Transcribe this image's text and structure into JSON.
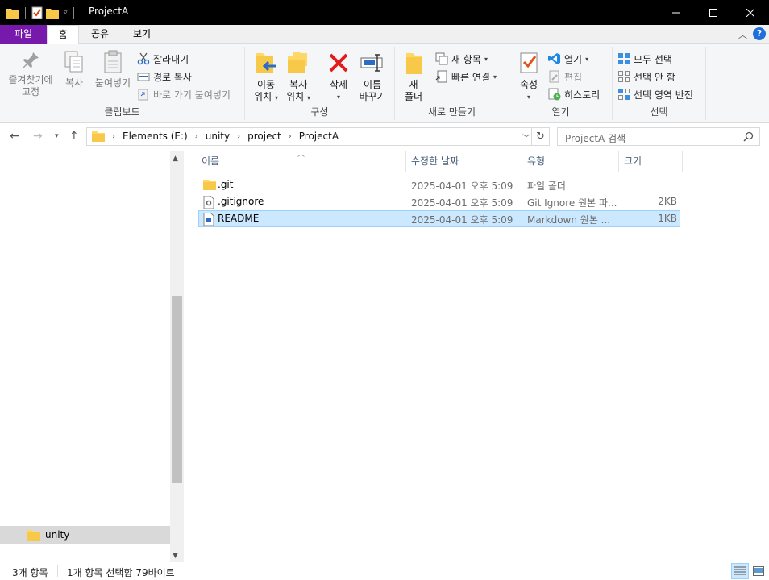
{
  "window": {
    "title": "ProjectA",
    "minimize_icon": "minimize-icon",
    "maximize_icon": "maximize-icon",
    "close_icon": "close-icon"
  },
  "tabs": {
    "file": "파일",
    "home": "홈",
    "share": "공유",
    "view": "보기"
  },
  "ribbon": {
    "clipboard": {
      "label": "클립보드",
      "pin_line1": "즐겨찾기에",
      "pin_line2": "고정",
      "copy": "복사",
      "paste": "붙여넣기",
      "cut": "잘라내기",
      "copy_path": "경로 복사",
      "paste_shortcut": "바로 가기 붙여넣기"
    },
    "organize": {
      "label": "구성",
      "move_line1": "이동",
      "move_line2": "위치",
      "copy_line1": "복사",
      "copy_line2": "위치",
      "delete": "삭제",
      "rename_line1": "이름",
      "rename_line2": "바꾸기"
    },
    "new": {
      "label": "새로 만들기",
      "folder_line1": "새",
      "folder_line2": "폴더",
      "new_item": "새 항목",
      "easy_access": "빠른 연결"
    },
    "open": {
      "label": "열기",
      "properties": "속성",
      "open": "열기",
      "edit": "편집",
      "history": "히스토리"
    },
    "select": {
      "label": "선택",
      "select_all": "모두 선택",
      "select_none": "선택 안 함",
      "invert": "선택 영역 반전"
    }
  },
  "address": {
    "crumbs": [
      "Elements (E:)",
      "unity",
      "project",
      "ProjectA"
    ],
    "search_placeholder": "ProjectA 검색"
  },
  "columns": {
    "name": "이름",
    "date": "수정한 날짜",
    "type": "유형",
    "size": "크기"
  },
  "files": [
    {
      "name": ".git",
      "date": "2025-04-01 오후 5:09",
      "type": "파일 폴더",
      "size": "",
      "icon": "folder-icon"
    },
    {
      "name": ".gitignore",
      "date": "2025-04-01 오후 5:09",
      "type": "Git Ignore 원본 파...",
      "size": "2KB",
      "icon": "gear-file-icon"
    },
    {
      "name": "README",
      "date": "2025-04-01 오후 5:09",
      "type": "Markdown 원본 ...",
      "size": "1KB",
      "icon": "markdown-file-icon",
      "selected": true
    }
  ],
  "nav_pane": {
    "items": [
      {
        "label": "unity",
        "icon": "folder-icon"
      }
    ]
  },
  "status": {
    "count": "3개 항목",
    "selection": "1개 항목 선택함 79바이트"
  },
  "colors": {
    "file_tab": "#7719aa",
    "selection_bg": "#cce8ff",
    "selection_border": "#99d1ff",
    "folder": "#ffd766"
  }
}
